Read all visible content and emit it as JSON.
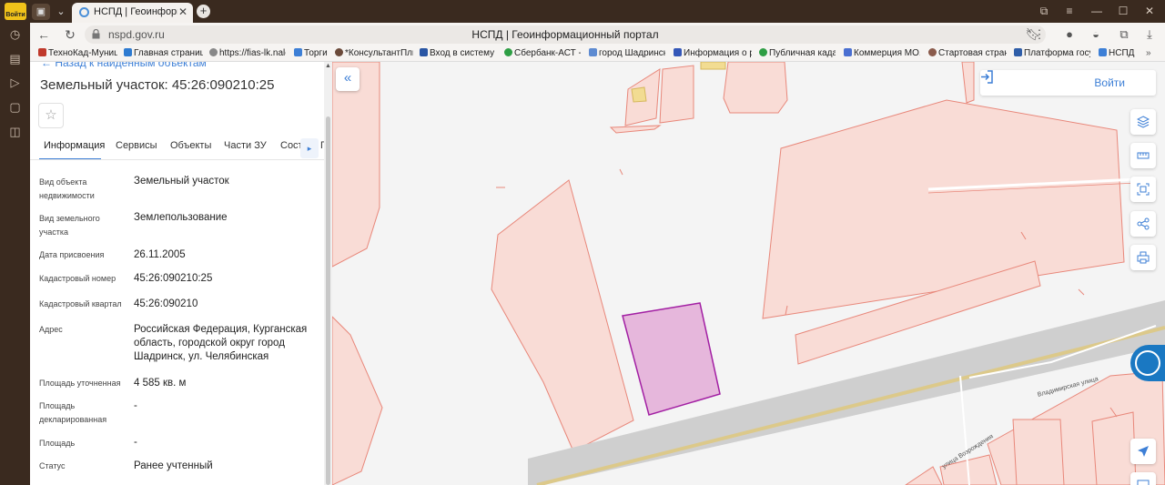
{
  "browser": {
    "tab_title": "НСПД | Геоинформационный портал",
    "url": "nspd.gov.ru",
    "page_title": "НСПД | Геоинформационный портал",
    "profile_label": "Войти",
    "bookmarks": [
      "ТехноКад-Муници...",
      "Главная страница",
      "https://fias-lk.nalog...",
      "Торги",
      "*КонсультантПлюс",
      "Вход в систему :: ...",
      "Сбербанк-АСТ - ...",
      "город Шадринск",
      "Информация о ра...",
      "Публичная кадаст...",
      "Коммерция МО.ха...",
      "Стартовая страни...",
      "Платформа госуд...",
      "НСПД"
    ]
  },
  "panel": {
    "back_link": "← Назад к найденным объектам",
    "title": "Земельный участок: 45:26:090210:25",
    "tabs": [
      "Информация",
      "Сервисы",
      "Объекты",
      "Части ЗУ",
      "Соста"
    ],
    "tab_clip": "П",
    "attributes": [
      {
        "label": "Вид объекта недвижимости",
        "value": "Земельный участок"
      },
      {
        "label": "Вид земельного участка",
        "value": "Землепользование"
      },
      {
        "label": "Дата присвоения",
        "value": "26.11.2005"
      },
      {
        "label": "Кадастровый номер",
        "value": "45:26:090210:25"
      },
      {
        "label": "Кадастровый квартал",
        "value": "45:26:090210"
      },
      {
        "label": "Адрес",
        "value": "Российская Федерация, Курганская область, городской округ город Шадринск, ул. Челябинская"
      },
      {
        "label": "Площадь уточненная",
        "value": "4 585 кв. м"
      },
      {
        "label": "Площадь декларированная",
        "value": "-"
      },
      {
        "label": "Площадь",
        "value": "-"
      },
      {
        "label": "Статус",
        "value": "Ранее учтенный"
      }
    ]
  },
  "map": {
    "login_label": "Войти",
    "streets": [
      "Владимирская улица",
      "улица Возрождения"
    ],
    "colors": {
      "parcel_fill": "#f9dcd6",
      "parcel_stroke": "#e8877a",
      "selected_fill": "#e6b7dc",
      "selected_stroke": "#a21fa3",
      "road": "#cfcfcf",
      "rail": "#dcc98a",
      "accent": "#3d7fd6"
    }
  }
}
